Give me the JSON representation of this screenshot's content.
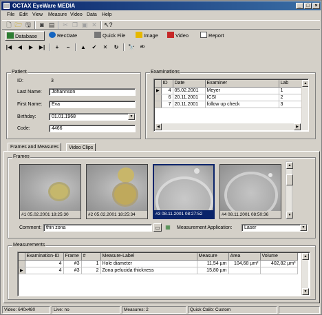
{
  "window": {
    "title": "OCTAX EyeWare MEDIA"
  },
  "menu": [
    "File",
    "Edit",
    "View",
    "Measure",
    "Video",
    "Data",
    "Help"
  ],
  "toolbar": {
    "icons": [
      "new-file-icon",
      "open-folder-icon",
      "save-icon",
      "camera-icon",
      "scanner-icon",
      "cut-icon",
      "copy-icon",
      "paste-icon",
      "delete-icon",
      "help-pointer-icon"
    ]
  },
  "modules": [
    {
      "label": "Database",
      "active": true
    },
    {
      "label": "RecDate",
      "active": false
    },
    {
      "label": "Quick File",
      "active": false
    },
    {
      "label": "Image",
      "active": false
    },
    {
      "label": "Video",
      "active": false
    },
    {
      "label": "Report",
      "active": false
    }
  ],
  "navigator": [
    "|◀",
    "◀",
    "▶",
    "▶|",
    "+",
    "−",
    "▲",
    "✔",
    "✕",
    "↻",
    "🔭",
    "ᵃᵇ"
  ],
  "patient": {
    "legend": "Patient",
    "id_label": "ID:",
    "id_value": "3",
    "last_name_label": "Last Name:",
    "last_name": "Johannson",
    "first_name_label": "First Name:",
    "first_name": "Eva",
    "birthday_label": "Birthday:",
    "birthday": "01.01.1968",
    "code_label": "Code:",
    "code": "4466"
  },
  "examinations": {
    "legend": "Examinations",
    "columns": [
      "ID",
      "Date",
      "Examiner",
      "Lab"
    ],
    "rows": [
      {
        "id": "4",
        "date": "05.02.2001",
        "examiner": "Meyer",
        "lab": "1",
        "current": true
      },
      {
        "id": "6",
        "date": "20.11.2001",
        "examiner": "ICSI",
        "lab": "2",
        "current": false
      },
      {
        "id": "7",
        "date": "20.11.2001",
        "examiner": "follow up check",
        "lab": "3",
        "current": false
      }
    ]
  },
  "tabs": [
    "Frames and Measures",
    "Video Clips"
  ],
  "frames": {
    "legend": "Frames",
    "items": [
      {
        "caption": "#1  05.02.2001 18:25:30",
        "selected": false
      },
      {
        "caption": "#2  05.02.2001 18:25:34",
        "selected": false
      },
      {
        "caption": "#3  08.11.2001 08:27:52",
        "selected": true
      },
      {
        "caption": "#4  08.11.2001 08:50:36",
        "selected": false
      }
    ],
    "comment_label": "Comment:",
    "comment": "thin zona",
    "app_label": "Measurement Application:",
    "app_value": "Laser"
  },
  "measurements": {
    "legend": "Measurements",
    "columns": [
      "Examination-ID",
      "Frame",
      "#",
      "Measure-Label",
      "Measure",
      "Area",
      "Volume"
    ],
    "rows": [
      {
        "exam": "4",
        "frame": "#3",
        "num": "1",
        "label": "Hole diameter",
        "measure": "11,54 µm",
        "area": "104,68 µm²",
        "volume": "402,82 µm³",
        "current": false
      },
      {
        "exam": "4",
        "frame": "#3",
        "num": "2",
        "label": "Zona pelucida thickness",
        "measure": "15,80 µm",
        "area": "",
        "volume": "",
        "current": true
      }
    ]
  },
  "status": {
    "video": "Video: 640x480",
    "live": "Live: no",
    "measures": "Measures: 2",
    "calib": "Quick Calib: Custom"
  }
}
